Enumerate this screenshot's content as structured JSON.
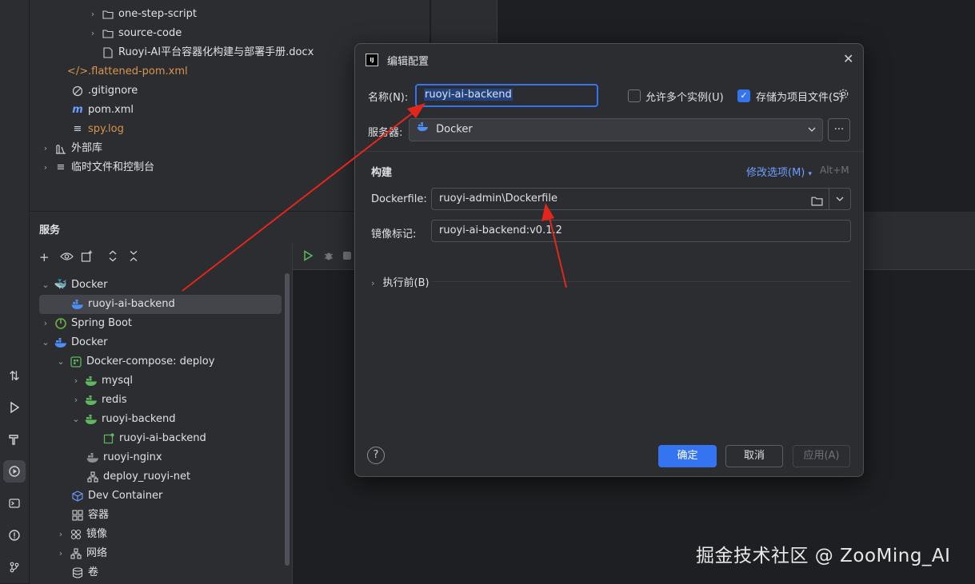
{
  "project_tree": [
    {
      "label": "one-step-script",
      "icon": "folder-icon",
      "chevron": "›"
    },
    {
      "label": "source-code",
      "icon": "folder-icon",
      "chevron": "›"
    },
    {
      "label": "Ruoyi-AI平台容器化构建与部署手册.docx",
      "icon": "document-icon",
      "chevron": ""
    },
    {
      "label": ".flattened-pom.xml",
      "icon": "xml-file-icon",
      "chevron": ""
    },
    {
      "label": ".gitignore",
      "icon": "gitignore-icon",
      "chevron": ""
    },
    {
      "label": "pom.xml",
      "icon": "maven-icon",
      "chevron": ""
    },
    {
      "label": "spy.log",
      "icon": "log-file-icon",
      "chevron": ""
    },
    {
      "label": "外部库",
      "icon": "library-icon",
      "chevron": "›"
    },
    {
      "label": "临时文件和控制台",
      "icon": "scratches-icon",
      "chevron": "›"
    }
  ],
  "services": {
    "title": "服务",
    "tree": [
      {
        "label": "Docker",
        "icon": "docker-icon",
        "chevron": "⌄"
      },
      {
        "label": "ruoyi-ai-backend",
        "icon": "docker-icon",
        "chevron": ""
      },
      {
        "label": "Spring Boot",
        "icon": "spring-boot-icon",
        "chevron": "›"
      },
      {
        "label": "Docker",
        "icon": "docker-icon",
        "chevron": "⌄"
      },
      {
        "label": "Docker-compose: deploy",
        "icon": "compose-icon",
        "chevron": "⌄"
      },
      {
        "label": "mysql",
        "icon": "docker-service-icon",
        "chevron": "›"
      },
      {
        "label": "redis",
        "icon": "docker-service-icon",
        "chevron": "›"
      },
      {
        "label": "ruoyi-backend",
        "icon": "docker-service-icon",
        "chevron": "⌄"
      },
      {
        "label": "ruoyi-ai-backend",
        "icon": "container-icon",
        "chevron": ""
      },
      {
        "label": "ruoyi-nginx",
        "icon": "docker-service-icon",
        "chevron": ""
      },
      {
        "label": "deploy_ruoyi-net",
        "icon": "network-icon",
        "chevron": ""
      },
      {
        "label": "Dev Container",
        "icon": "dev-container-icon",
        "chevron": ""
      },
      {
        "label": "容器",
        "icon": "containers-icon",
        "chevron": ""
      },
      {
        "label": "镜像",
        "icon": "images-icon",
        "chevron": "›"
      },
      {
        "label": "网络",
        "icon": "network-icon",
        "chevron": "›"
      },
      {
        "label": "卷",
        "icon": "volumes-icon",
        "chevron": ""
      }
    ]
  },
  "dialog": {
    "title": "编辑配置",
    "name_label": "名称(N):",
    "name_value": "ruoyi-ai-backend",
    "allow_multiple_label": "允许多个实例(U)",
    "allow_multiple_checked": false,
    "store_as_project_label": "存储为项目文件(S)",
    "store_as_project_checked": true,
    "server_label": "服务器:",
    "server_value": "Docker",
    "more_button": "...",
    "build_section": "构建",
    "modify_options": "修改选项(M)",
    "modify_shortcut": "Alt+M",
    "dockerfile_label": "Dockerfile:",
    "dockerfile_value": "ruoyi-admin\\Dockerfile",
    "image_tag_label": "镜像标记:",
    "image_tag_value": "ruoyi-ai-backend:v0.1.2",
    "before_launch": "执行前(B)",
    "ok_button": "确定",
    "cancel_button": "取消",
    "apply_button": "应用(A)",
    "help_button": "?"
  },
  "watermark": "掘金技术社区 @ ZooMing_AI",
  "colors": {
    "accent": "#3574f0",
    "annotation_arrow": "#e3261c",
    "docker_blue": "#4e8ff5",
    "green_service": "#5fb85f"
  }
}
